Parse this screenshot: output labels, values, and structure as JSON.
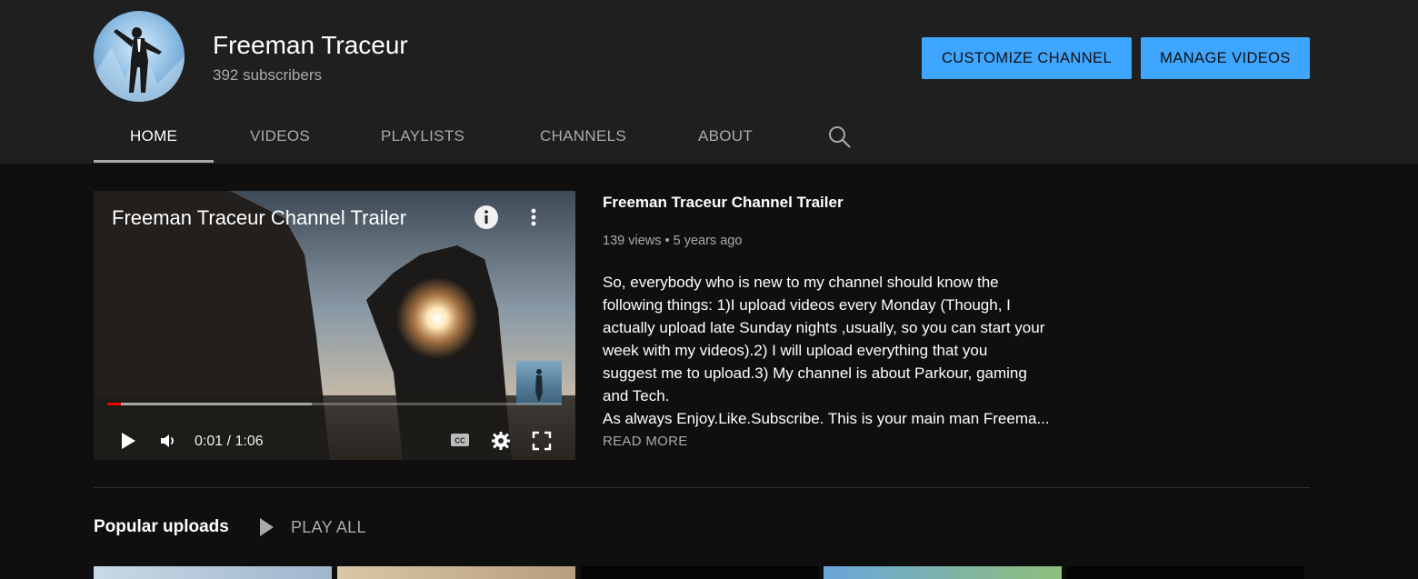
{
  "channel": {
    "name": "Freeman Traceur",
    "subscribers": "392 subscribers"
  },
  "actions": {
    "customize_label": "CUSTOMIZE CHANNEL",
    "manage_label": "MANAGE VIDEOS"
  },
  "tabs": [
    {
      "label": "HOME",
      "active": true
    },
    {
      "label": "VIDEOS",
      "active": false
    },
    {
      "label": "PLAYLISTS",
      "active": false
    },
    {
      "label": "CHANNELS",
      "active": false
    },
    {
      "label": "ABOUT",
      "active": false
    }
  ],
  "trailer": {
    "overlay_title": "Freeman Traceur Channel Trailer",
    "title": "Freeman Traceur Channel Trailer",
    "views": "139 views",
    "age": "5 years ago",
    "time": "0:01 / 1:06",
    "progress_played": 0.03,
    "progress_buffered": 0.45,
    "description_lines": [
      "So, everybody who is new to my channel should know the",
      "following things: 1)I upload videos every Monday (Though, I",
      "actually upload late Sunday nights ,usually, so you can start your",
      "week with my videos).2) I will upload everything that you",
      "suggest me to upload.3) My channel is about Parkour, gaming",
      "and Tech.",
      "As always Enjoy.Like.Subscribe. This is your main man Freema..."
    ],
    "read_more": "READ MORE"
  },
  "popular": {
    "title": "Popular uploads",
    "play_all": "PLAY ALL"
  },
  "icons": {
    "search": "search-icon",
    "info": "info-icon",
    "more": "more-vert-icon",
    "play": "play-icon",
    "volume": "volume-icon",
    "cc": "closed-captions-icon",
    "settings": "settings-gear-icon",
    "fullscreen": "fullscreen-icon"
  },
  "colors": {
    "accent": "#3ea6ff",
    "header_bg": "#1f1f1f",
    "page_bg": "#0f0f0f",
    "progress": "#ff0000"
  }
}
